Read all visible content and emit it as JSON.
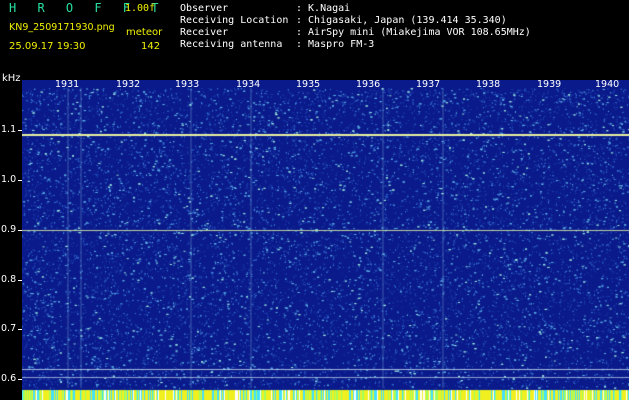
{
  "header": {
    "brand": "H R O F F T",
    "version": "1.00f",
    "filename": "KN9_2509171930.png",
    "mode": "meteor",
    "datetime": "25.09.17 19:30",
    "count": "142",
    "info": [
      {
        "label": "Observer",
        "value": ": K.Nagai"
      },
      {
        "label": "Receiving Location",
        "value": ": Chigasaki, Japan (139.414 35.340)"
      },
      {
        "label": "Receiver",
        "value": ": AirSpy mini (Miakejima VOR 108.65MHz)"
      },
      {
        "label": "Receiving antenna",
        "value": ": Maspro FM-3"
      }
    ]
  },
  "axis": {
    "unit": "kHz",
    "y_ticks": [
      "1.1",
      "1.0",
      "0.9",
      "0.8",
      "0.7",
      "0.6"
    ],
    "x_ticks": [
      "1931",
      "1932",
      "1933",
      "1934",
      "1935",
      "1936",
      "1937",
      "1938",
      "1939",
      "1940"
    ]
  },
  "colors": {
    "background": "#0a1a8a",
    "noise_low": "#3a7ad8",
    "noise_high": "#9ae8e0",
    "signal": "#e8f0a0",
    "bottom_band": "#f0f020",
    "brand": "#27e0a0",
    "meta": "#f0f000"
  }
}
